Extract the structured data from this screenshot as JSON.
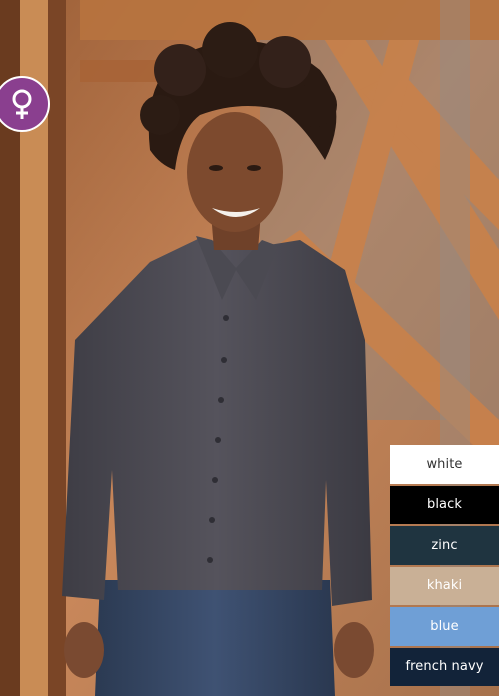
{
  "badge": {
    "icon": "female-symbol-icon",
    "color": "#8a3f8f"
  },
  "colors": [
    {
      "label": "white",
      "bg": "#ffffff",
      "fg": "#333333"
    },
    {
      "label": "black",
      "bg": "#000000",
      "fg": "#ffffff"
    },
    {
      "label": "zinc",
      "bg": "#1f3440",
      "fg": "#ffffff"
    },
    {
      "label": "khaki",
      "bg": "#c9b096",
      "fg": "#ffffff"
    },
    {
      "label": "blue",
      "bg": "#6f9fd6",
      "fg": "#ffffff"
    },
    {
      "label": "french navy",
      "bg": "#122339",
      "fg": "#ffffff"
    }
  ]
}
